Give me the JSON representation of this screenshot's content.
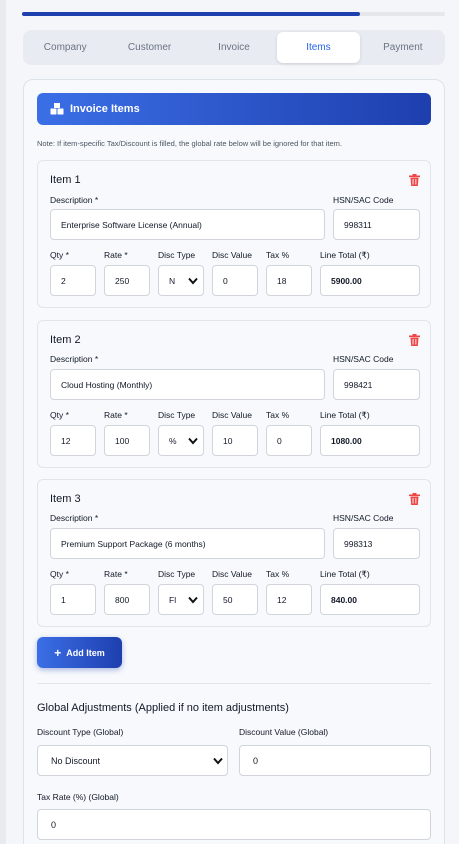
{
  "progress": {
    "value_fraction": 0.8
  },
  "tabs": [
    {
      "label": "Company"
    },
    {
      "label": "Customer"
    },
    {
      "label": "Invoice"
    },
    {
      "label": "Items"
    },
    {
      "label": "Payment"
    }
  ],
  "active_tab": "Items",
  "section": {
    "title": "Invoice Items",
    "note": "Note: If item-specific Tax/Discount is filled, the global rate below will be ignored for that item."
  },
  "labels": {
    "description": "Description *",
    "hsn": "HSN/SAC Code",
    "qty": "Qty *",
    "rate": "Rate *",
    "disc_type": "Disc Type",
    "disc_value": "Disc Value",
    "tax": "Tax %",
    "line_total": "Line Total (₹)"
  },
  "items": [
    {
      "title": "Item 1",
      "description": "Enterprise Software License (Annual)",
      "hsn": "998311",
      "qty": "2",
      "rate": "250",
      "disc_type": "N",
      "disc_value": "0",
      "tax": "18",
      "line_total": "5900.00"
    },
    {
      "title": "Item 2",
      "description": "Cloud Hosting (Monthly)",
      "hsn": "998421",
      "qty": "12",
      "rate": "100",
      "disc_type": "%",
      "disc_value": "10",
      "tax": "0",
      "line_total": "1080.00"
    },
    {
      "title": "Item 3",
      "description": "Premium Support Package (6 months)",
      "hsn": "998313",
      "qty": "1",
      "rate": "800",
      "disc_type": "Fl",
      "disc_value": "50",
      "tax": "12",
      "line_total": "840.00"
    }
  ],
  "add_item_label": "Add Item",
  "global": {
    "title": "Global Adjustments (Applied if no item adjustments)",
    "discount_type_label": "Discount Type (Global)",
    "discount_type_value": "No Discount",
    "discount_value_label": "Discount Value (Global)",
    "discount_value": "0",
    "tax_rate_label": "Tax Rate (%) (Global)",
    "tax_rate_value": "0"
  },
  "icons": {
    "banner": "boxes-icon",
    "delete": "trash-icon",
    "add": "plus-icon",
    "dropdown": "chevron-down-icon"
  },
  "colors": {
    "accent": "#2563eb",
    "banner_start": "#3b6fe6",
    "banner_end": "#1e3fae",
    "delete": "#ef4444",
    "progress": "#1e40af"
  }
}
